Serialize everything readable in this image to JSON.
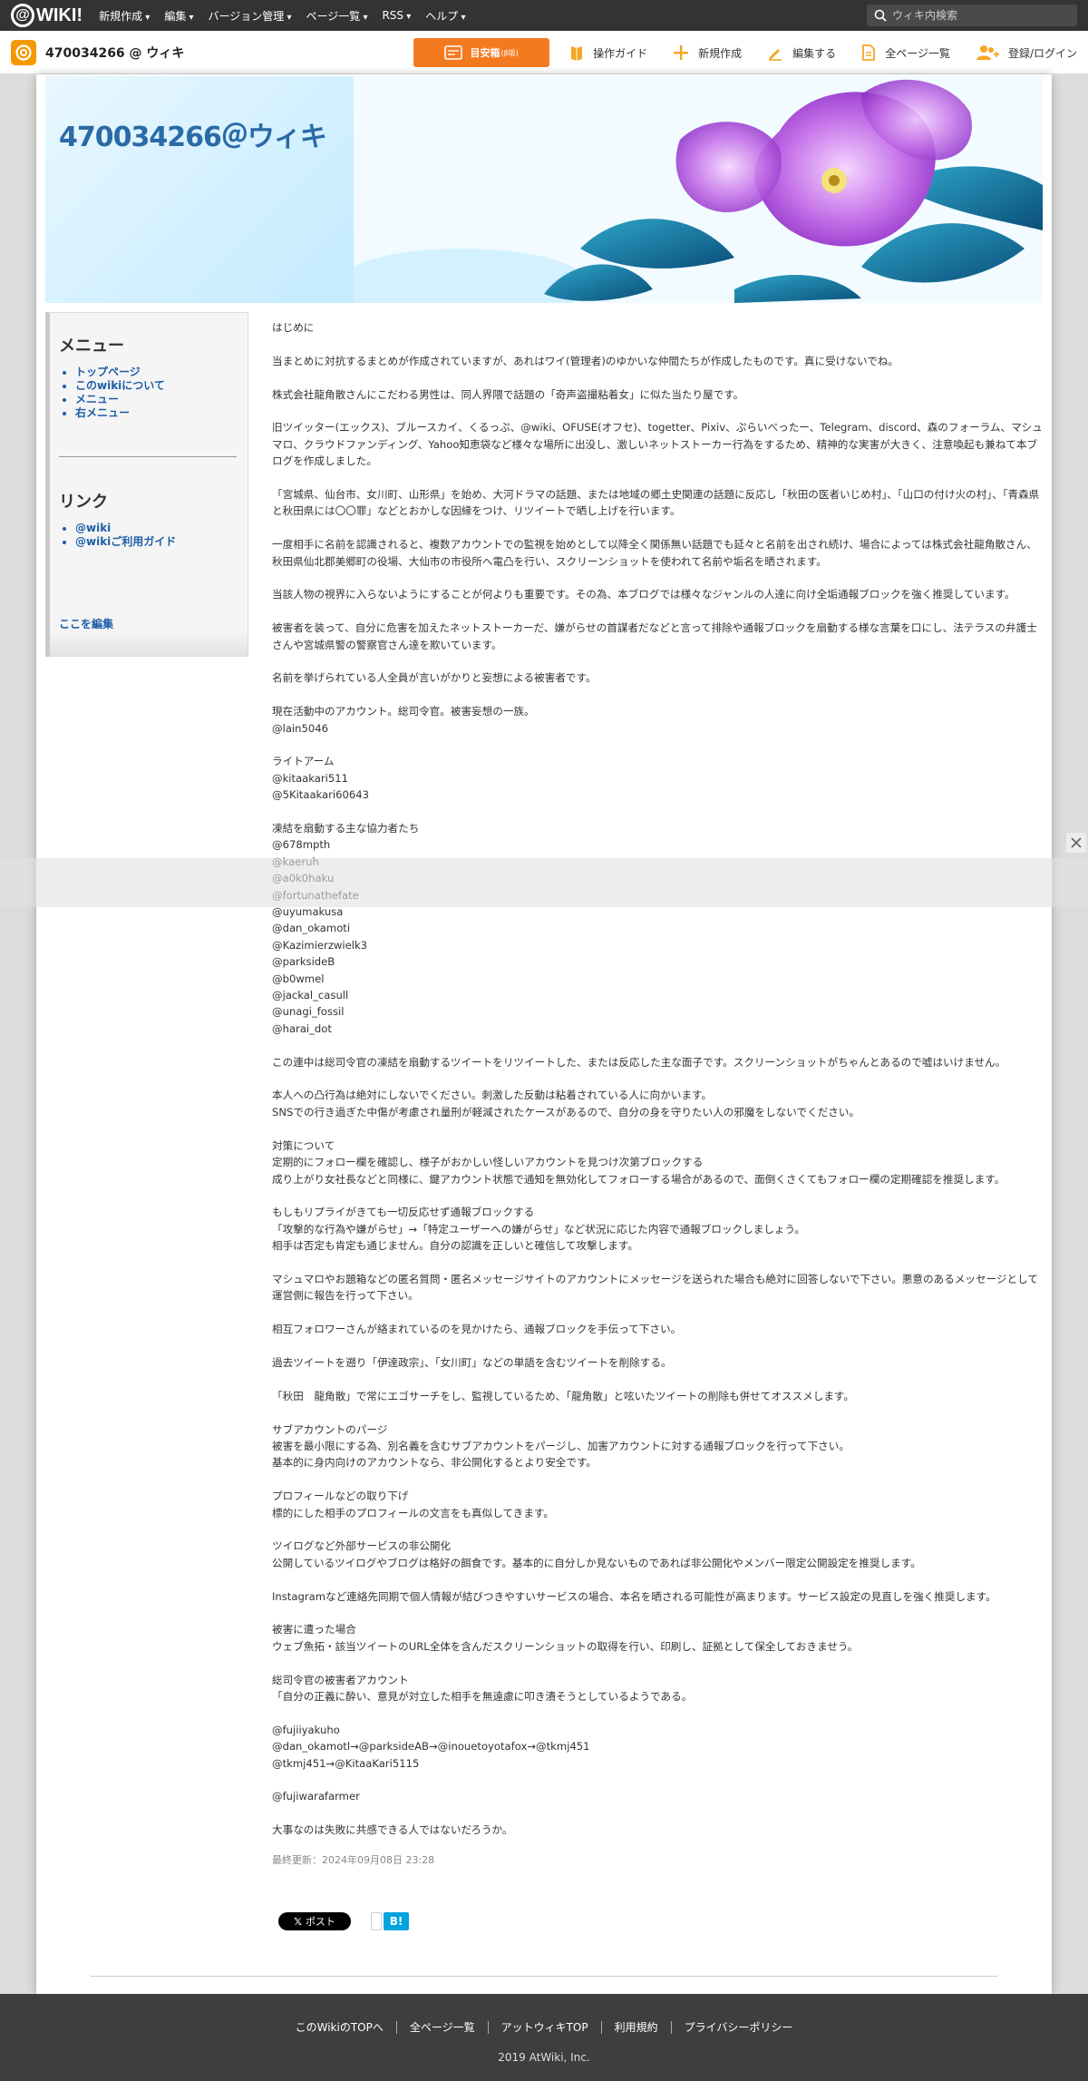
{
  "topbar": {
    "logo_text": "WIKI!",
    "nav": [
      "新規作成",
      "編集",
      "バージョン管理",
      "ページ一覧",
      "RSS",
      "ヘルプ"
    ],
    "search_placeholder": "ウィキ内検索"
  },
  "sitebar": {
    "site_name": "470034266 @ ウィキ",
    "cta_label": "目安箱",
    "cta_sub": "(β版)",
    "tools": [
      "操作ガイド",
      "新規作成",
      "編集する",
      "全ページ一覧",
      "登録/ログイン"
    ]
  },
  "header": {
    "title": "470034266＠ウィキ"
  },
  "sidebar": {
    "menu_heading": "メニュー",
    "menu_items": [
      "トップページ",
      "このwikiについて",
      "メニュー",
      "右メニュー"
    ],
    "link_heading": "リンク",
    "link_items": [
      "@wiki",
      "@wikiご利用ガイド"
    ],
    "edit_here": "ここを編集"
  },
  "content": {
    "paragraphs": [
      "はじめに",
      "当まとめに対抗するまとめが作成されていますが、あれはワイ(管理者)のゆかいな仲間たちが作成したものです。真に受けないでね。",
      "株式会社龍角散さんにこだわる男性は、同人界隈で話題の「奇声盗撮粘着女」に似た当たり屋です。",
      "旧ツイッター(エックス)、ブルースカイ、くるっぷ、@wiki、OFUSE(オフセ)、togetter、Pixiv、ぷらいべったー、Telegram、discord、森のフォーラム、マシュマロ、クラウドファンディング、Yahoo知恵袋など様々な場所に出没し、激しいネットストーカー行為をするため、精神的な実害が大きく、注意喚起も兼ねて本ブログを作成しました。",
      "「宮城県、仙台市、女川町、山形県」を始め、大河ドラマの話題、または地域の郷土史関連の話題に反応し「秋田の医者いじめ村」、「山口の付け火の村」、「青森県と秋田県には〇〇罪」などとおかしな因縁をつけ、リツイートで晒し上げを行います。",
      "一度相手に名前を認識されると、複数アカウントでの監視を始めとして以降全く関係無い話題でも延々と名前を出され続け、場合によっては株式会社龍角散さん、秋田県仙北郡美郷町の役場、大仙市の市役所へ電凸を行い、スクリーンショットを使われて名前や垢名を晒されます。",
      "当該人物の視界に入らないようにすることが何よりも重要です。その為、本ブログでは様々なジャンルの人達に向け全垢通報ブロックを強く推奨しています。",
      "被害者を装って、自分に危害を加えたネットストーカーだ、嫌がらせの首謀者だなどと言って排除や通報ブロックを扇動する様な言葉を口にし、法テラスの弁護士さんや宮城県警の警察官さん達を欺いています。",
      "名前を挙げられている人全員が言いがかりと妄想による被害者です。",
      "現在活動中のアカウント。総司令官。被害妄想の一族。\n@lain5046",
      "ライトアーム\n@kitaakari511\n@5Kitaakari60643",
      "凍結を扇動する主な協力者たち\n@678mpth\n@kaeruh\n@a0k0haku\n@fortunathefate\n@uyumakusa\n@dan_okamoti\n@Kazimierzwielk3\n@parksideB\n@b0wmel\n@jackal_casull\n@unagi_fossil\n@harai_dot",
      "この連中は総司令官の凍結を扇動するツイートをリツイートした、または反応した主な面子です。スクリーンショットがちゃんとあるので嘘はいけません。",
      "本人への凸行為は絶対にしないでください。刺激した反動は粘着されている人に向かいます。\nSNSでの行き過ぎた中傷が考慮され量刑が軽減されたケースがあるので、自分の身を守りたい人の邪魔をしないでください。",
      "対策について\n定期的にフォロー欄を確認し、様子がおかしい怪しいアカウントを見つけ次第ブロックする\n成り上がり女社長などと同様に、鍵アカウント状態で通知を無効化してフォローする場合があるので、面倒くさくてもフォロー欄の定期確認を推奨します。",
      "もしもリプライがきても一切反応せず通報ブロックする\n「攻撃的な行為や嫌がらせ」→「特定ユーザーへの嫌がらせ」など状況に応じた内容で通報ブロックしましょう。\n相手は否定も肯定も通じません。自分の認識を正しいと確信して攻撃します。",
      "マシュマロやお題箱などの匿名質問・匿名メッセージサイトのアカウントにメッセージを送られた場合も絶対に回答しないで下さい。悪意のあるメッセージとして運営側に報告を行って下さい。",
      "相互フォロワーさんが絡まれているのを見かけたら、通報ブロックを手伝って下さい。",
      "過去ツイートを遡り「伊達政宗」、「女川町」などの単語を含むツイートを削除する。",
      "「秋田　龍角散」で常にエゴサーチをし、監視しているため、「龍角散」と呟いたツイートの削除も併せてオススメします。",
      "サブアカウントのパージ\n被害を最小限にする為、別名義を含むサブアカウントをパージし、加害アカウントに対する通報ブロックを行って下さい。\n基本的に身内向けのアカウントなら、非公開化するとより安全です。",
      "プロフィールなどの取り下げ\n標的にした相手のプロフィールの文言をも真似してきます。",
      "ツイログなど外部サービスの非公開化\n公開しているツイログやブログは格好の餌食です。基本的に自分しか見ないものであれば非公開化やメンバー限定公開設定を推奨します。",
      "Instagramなど連絡先同期で個人情報が結びつきやすいサービスの場合、本名を晒される可能性が高まります。サービス設定の見直しを強く推奨します。",
      "被害に遭った場合\nウェブ魚拓・該当ツイートのURL全体を含んだスクリーンショットの取得を行い、印刷し、証拠として保全しておきませう。",
      "総司令官の被害者アカウント\n「自分の正義に酔い、意見が対立した相手を無遠慮に叩き潰そうとしているようである。",
      "@fujiiyakuho\n@dan_okamotl→@parksideAB→@inouetoyotafox→@tkmj451\n@tkmj451→@KitaaKari5115",
      "@fujiwarafarmer",
      "大事なのは失敗に共感できる人ではないだろうか。"
    ],
    "last_updated": "最終更新：2024年09月08日 23:28"
  },
  "share": {
    "x_label": "ポスト",
    "hatena_label": "B!"
  },
  "footer": {
    "links": [
      "このWikiのTOPへ",
      "全ページ一覧",
      "アットウィキTOP",
      "利用規約",
      "プライバシーポリシー"
    ],
    "copyright": "2019 AtWiki, Inc."
  }
}
